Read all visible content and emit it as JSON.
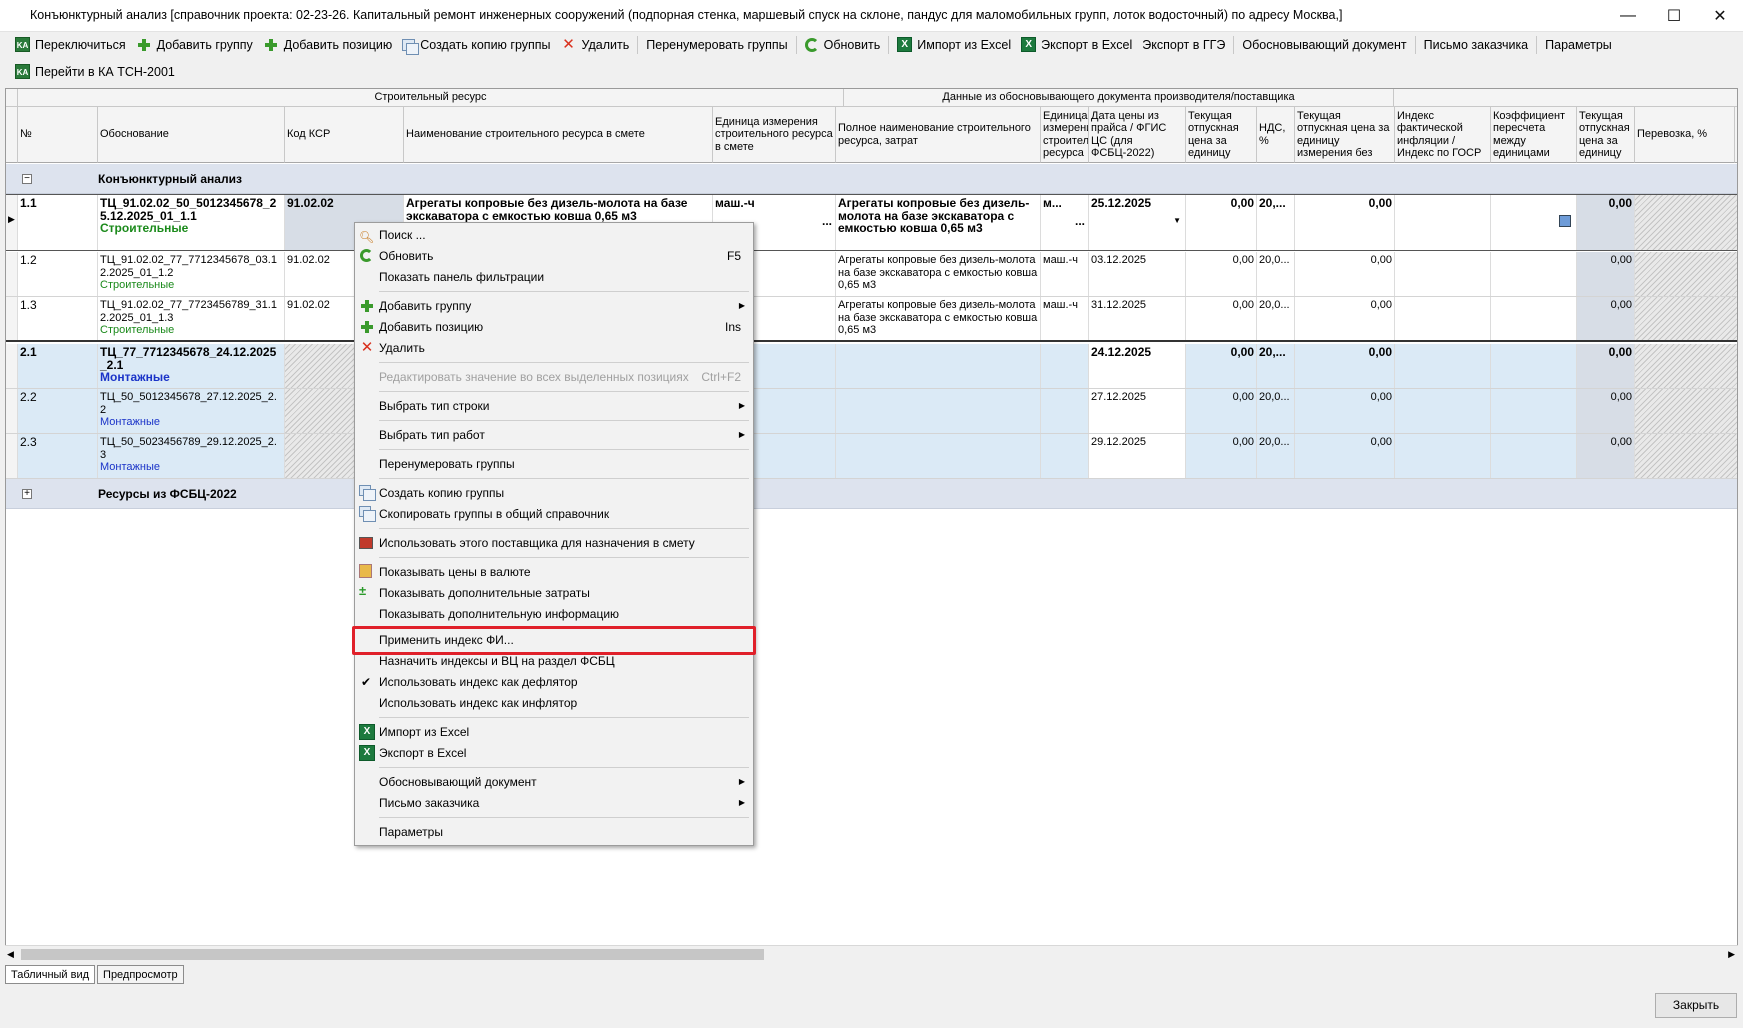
{
  "window": {
    "title": "Конъюнктурный анализ [справочник проекта: 02-23-26. Капитальный ремонт инженерных сооружений (подпорная стенка, маршевый спуск на склоне, пандус для маломобильных групп, лоток водосточный) по адресу Москва,]",
    "minimize": "—",
    "maximize": "☐",
    "close": "✕"
  },
  "toolbar1": {
    "switch": "Переключиться",
    "add_group": "Добавить группу",
    "add_position": "Добавить позицию",
    "copy_group": "Создать копию группы",
    "delete": "Удалить",
    "renumber": "Перенумеровать группы",
    "refresh": "Обновить",
    "import_excel": "Импорт из Excel",
    "export_excel": "Экспорт в Excel",
    "export_gge": "Экспорт в ГГЭ",
    "justifying_doc": "Обосновывающий документ",
    "customer_letter": "Письмо заказчика",
    "params": "Параметры"
  },
  "toolbar2": {
    "goto_ka": "Перейти в КА ТСН-2001"
  },
  "grid": {
    "band_resource": "Строительный ресурс",
    "band_supplier": "Данные из обосновывающего документа производителя/поставщика",
    "columns": [
      "№",
      "Обоснование",
      "Код КСР",
      "Наименование строительного ресурса в смете",
      "Единица измерения строительного ресурса в смете",
      "Полное наименование строительного ресурса, затрат",
      "Единица измерения строительного ресурса",
      "Дата цены из прайса / ФГИС ЦС (для ФСБЦ-2022)",
      "Текущая отпускная цена за единицу",
      "НДС, %",
      "Текущая отпускная цена за единицу измерения без",
      "Индекс фактической инфляции / Индекс по ГОСР",
      "Коэффициент пересчета между единицами",
      "Текущая отпускная цена за единицу",
      "Перевозка, %",
      "П"
    ],
    "group1": {
      "expander": "−",
      "label": "Конъюнктурный анализ"
    },
    "group2": {
      "expander": "+",
      "label": "Ресурсы из ФСБЦ-2022"
    },
    "rows": [
      {
        "num": "1.1",
        "basis": "ТЦ_91.02.02_50_5012345678_25.12.2025_01_1.1",
        "type": "Строительные",
        "ksr": "91.02.02",
        "name": "Агрегаты копровые без дизель-молота на базе экскаватора с емкостью ковша 0,65 м3",
        "unit": "маш.-ч",
        "full_name": "Агрегаты копровые без дизель-молота на базе экскаватора с емкостью ковша 0,65 м3",
        "unit2": "м...",
        "date": "25.12.2025",
        "price": "0,00",
        "vat": "20,...",
        "price_novat": "0,00",
        "cur_price": "0,00"
      },
      {
        "num": "1.2",
        "basis": "ТЦ_91.02.02_77_7712345678_03.12.2025_01_1.2",
        "type": "Строительные",
        "ksr": "91.02.02",
        "full_name": "Агрегаты копровые без дизель-молота на базе экскаватора с емкостью ковша 0,65 м3",
        "unit2": "маш.-ч",
        "date": "03.12.2025",
        "price": "0,00",
        "vat": "20,0...",
        "price_novat": "0,00",
        "cur_price": "0,00"
      },
      {
        "num": "1.3",
        "basis": "ТЦ_91.02.02_77_7723456789_31.12.2025_01_1.3",
        "type": "Строительные",
        "ksr": "91.02.02",
        "full_name": "Агрегаты копровые без дизель-молота на базе экскаватора с емкостью ковша 0,65 м3",
        "unit2": "маш.-ч",
        "date": "31.12.2025",
        "price": "0,00",
        "vat": "20,0...",
        "price_novat": "0,00",
        "cur_price": "0,00"
      },
      {
        "num": "2.1",
        "basis": "ТЦ_77_7712345678_24.12.2025_2.1",
        "type": "Монтажные",
        "date": "24.12.2025",
        "price": "0,00",
        "vat": "20,...",
        "price_novat": "0,00",
        "cur_price": "0,00"
      },
      {
        "num": "2.2",
        "basis": "ТЦ_50_5012345678_27.12.2025_2.2",
        "type": "Монтажные",
        "date": "27.12.2025",
        "price": "0,00",
        "vat": "20,0...",
        "price_novat": "0,00",
        "cur_price": "0,00"
      },
      {
        "num": "2.3",
        "basis": "ТЦ_50_5023456789_29.12.2025_2.3",
        "type": "Монтажные",
        "date": "29.12.2025",
        "price": "0,00",
        "vat": "20,0...",
        "price_novat": "0,00",
        "cur_price": "0,00"
      }
    ],
    "ellipsis": "..."
  },
  "context_menu": {
    "search": "Поиск ...",
    "refresh": "Обновить",
    "refresh_sc": "F5",
    "filter_panel": "Показать панель фильтрации",
    "add_group": "Добавить группу",
    "add_position": "Добавить позицию",
    "add_position_sc": "Ins",
    "delete": "Удалить",
    "edit_all": "Редактировать значение во всех выделенных позициях",
    "edit_all_sc": "Ctrl+F2",
    "row_type": "Выбрать тип строки",
    "work_type": "Выбрать тип работ",
    "renumber": "Перенумеровать группы",
    "copy_group": "Создать копию группы",
    "copy_to_common": "Скопировать группы в общий справочник",
    "use_supplier": "Использовать этого поставщика для назначения в смету",
    "show_currency": "Показывать цены в валюте",
    "show_extra_costs": "Показывать дополнительные затраты",
    "show_extra_info": "Показывать дополнительную информацию",
    "apply_index": "Применить индекс ФИ...",
    "assign_indexes": "Назначить индексы и ВЦ на раздел ФСБЦ",
    "use_deflator": "Использовать индекс как дефлятор",
    "use_inflator": "Использовать индекс как инфлятор",
    "check": "✔",
    "import_excel": "Импорт из Excel",
    "export_excel": "Экспорт в Excel",
    "justifying_doc": "Обосновывающий документ",
    "customer_letter": "Письмо заказчика",
    "params": "Параметры",
    "submenu_arrow": "▶"
  },
  "tabs": {
    "table": "Табличный вид",
    "preview": "Предпросмотр"
  },
  "footer": {
    "close": "Закрыть"
  },
  "colors": {
    "highlight": "#e0202a",
    "group_bg": "#dde3ee",
    "selected_bg": "#dbeaf6"
  }
}
